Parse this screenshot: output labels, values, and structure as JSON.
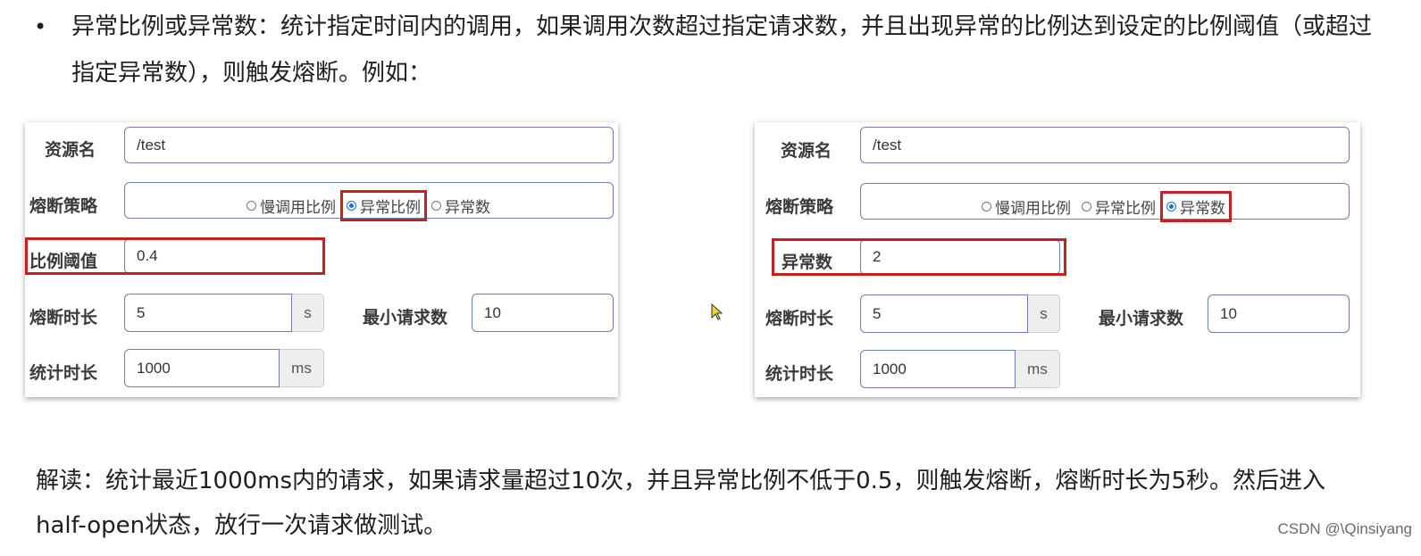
{
  "intro": {
    "bullet": "•",
    "text": "异常比例或异常数：统计指定时间内的调用，如果调用次数超过指定请求数，并且出现异常的比例达到设定的比例阈值（或超过指定异常数），则触发熔断。例如："
  },
  "left_form": {
    "resource_label": "资源名",
    "resource_value": "/test",
    "strategy_label": "熔断策略",
    "strategy_options": [
      "慢调用比例",
      "异常比例",
      "异常数"
    ],
    "strategy_selected": "异常比例",
    "threshold_label": "比例阈值",
    "threshold_value": "0.4",
    "duration_label": "熔断时长",
    "duration_value": "5",
    "duration_unit": "s",
    "min_req_label": "最小请求数",
    "min_req_value": "10",
    "stat_label": "统计时长",
    "stat_value": "1000",
    "stat_unit": "ms"
  },
  "right_form": {
    "resource_label": "资源名",
    "resource_value": "/test",
    "strategy_label": "熔断策略",
    "strategy_options": [
      "慢调用比例",
      "异常比例",
      "异常数"
    ],
    "strategy_selected": "异常数",
    "count_label": "异常数",
    "count_value": "2",
    "duration_label": "熔断时长",
    "duration_value": "5",
    "duration_unit": "s",
    "min_req_label": "最小请求数",
    "min_req_value": "10",
    "stat_label": "统计时长",
    "stat_value": "1000",
    "stat_unit": "ms"
  },
  "note": {
    "text": "解读：统计最近1000ms内的请求，如果请求量超过10次，并且异常比例不低于0.5，则触发熔断，熔断时长为5秒。然后进入half-open状态，放行一次请求做测试。"
  },
  "watermark": "CSDN @\\Qinsiyang",
  "colors": {
    "highlight": "#c62020",
    "radio_selected": "#1a6fe0",
    "input_border": "#6b7fb0"
  }
}
